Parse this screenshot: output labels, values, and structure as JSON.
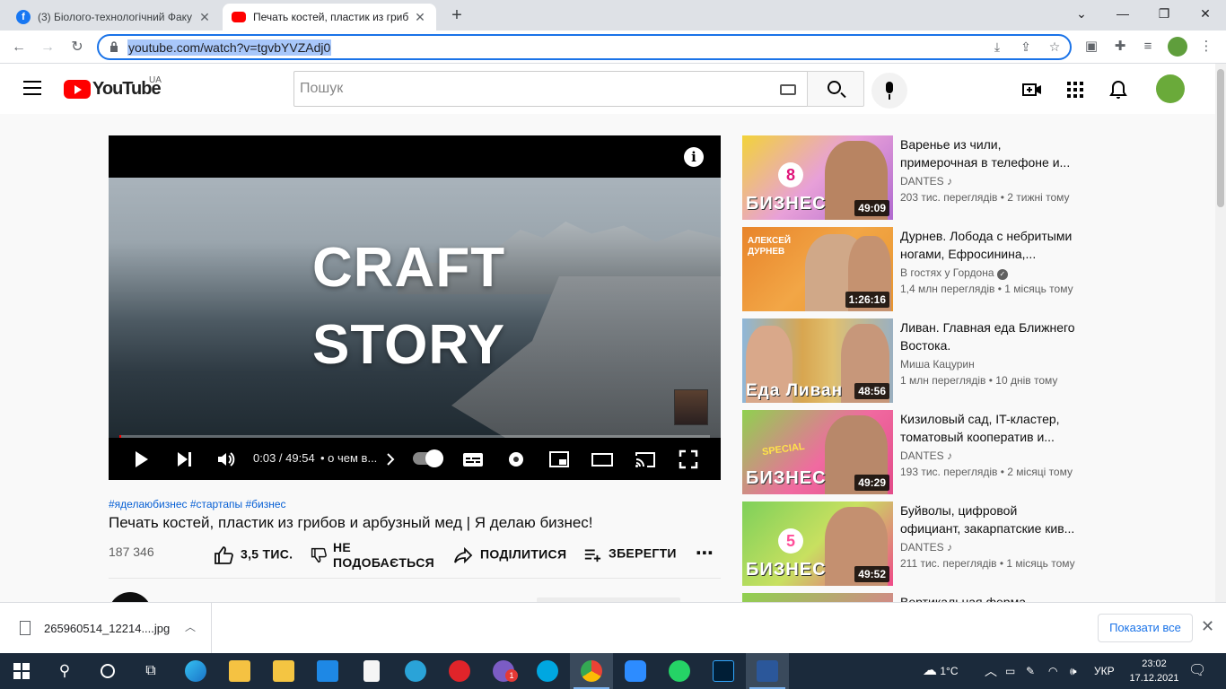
{
  "browser": {
    "tabs": [
      {
        "title": "(3) Біолого-технологічний Факу",
        "active": false
      },
      {
        "title": "Печать костей, пластик из гриб",
        "active": true
      }
    ],
    "url": "youtube.com/watch?v=tgvbYVZAdj0"
  },
  "youtube": {
    "logo": "YouTube",
    "region": "UA",
    "search_placeholder": "Пошук"
  },
  "player": {
    "overlay_line1": "CRAFT",
    "overlay_line2": "STORY",
    "time": "0:03 / 49:54",
    "chapter": "• о чем в...",
    "progress": 0.001
  },
  "video": {
    "hashtags": "#яделаюбизнес #стартапы #бизнес",
    "title": "Печать костей, пластик из грибов и арбузный мед | Я делаю бизнес!",
    "views": "187 346",
    "like_label": "3,5 ТИС.",
    "dislike_line1": "НЕ",
    "dislike_line2": "ПОДОБАЄТЬСЯ",
    "share_label": "ПОДІЛИТИСЯ",
    "save_label": "ЗБЕРЕГТИ"
  },
  "recommendations": [
    {
      "title_line1": "Варенье из чили,",
      "title_line2": "примерочная в телефоне и...",
      "channel": "DANTES",
      "meta": "203 тис. переглядів • 2 тижні тому",
      "duration": "49:09",
      "thumb_text": "БИЗНЕС",
      "thumb_num": "8"
    },
    {
      "title_line1": "Дурнев. Лобода с небритыми",
      "title_line2": "ногами, Ефросинина,...",
      "channel": "В гостях у Гордона",
      "meta": "1,4 млн переглядів • 1 місяць тому",
      "duration": "1:26:16",
      "thumb_text": "АЛЕКСЕЙ ДУРНЕВ",
      "thumb_num": ""
    },
    {
      "title_line1": "Ливан. Главная еда Ближнего",
      "title_line2": "Востока.",
      "channel": "Миша Кацурин",
      "meta": "1 млн переглядів • 10 днів тому",
      "duration": "48:56",
      "thumb_text": "Еда Ливан",
      "thumb_num": ""
    },
    {
      "title_line1": "Кизиловый сад, IT-кластер,",
      "title_line2": "томатовый кооператив и...",
      "channel": "DANTES",
      "meta": "193 тис. переглядів • 2 місяці тому",
      "duration": "49:29",
      "thumb_text": "БИЗНЕС",
      "thumb_num": "SPECIAL"
    },
    {
      "title_line1": "Буйволы, цифровой",
      "title_line2": "официант, закарпатские кив...",
      "channel": "DANTES",
      "meta": "211 тис. переглядів • 1 місяць тому",
      "duration": "49:52",
      "thumb_text": "БИЗНЕС",
      "thumb_num": "5"
    },
    {
      "title_line1": "Вертикальная ферма",
      "title_line2": "",
      "channel": "",
      "meta": "",
      "duration": "",
      "thumb_text": "",
      "thumb_num": ""
    }
  ],
  "downloads": {
    "file": "265960514_12214....jpg",
    "show_all": "Показати все"
  },
  "taskbar": {
    "weather": "1°C",
    "lang": "УКР",
    "time": "23:02",
    "date": "17.12.2021",
    "viber_badge": "1"
  },
  "colors": {
    "yt_red": "#ff0000",
    "link_blue": "#065fd4",
    "chrome_accent": "#1a73e8"
  }
}
